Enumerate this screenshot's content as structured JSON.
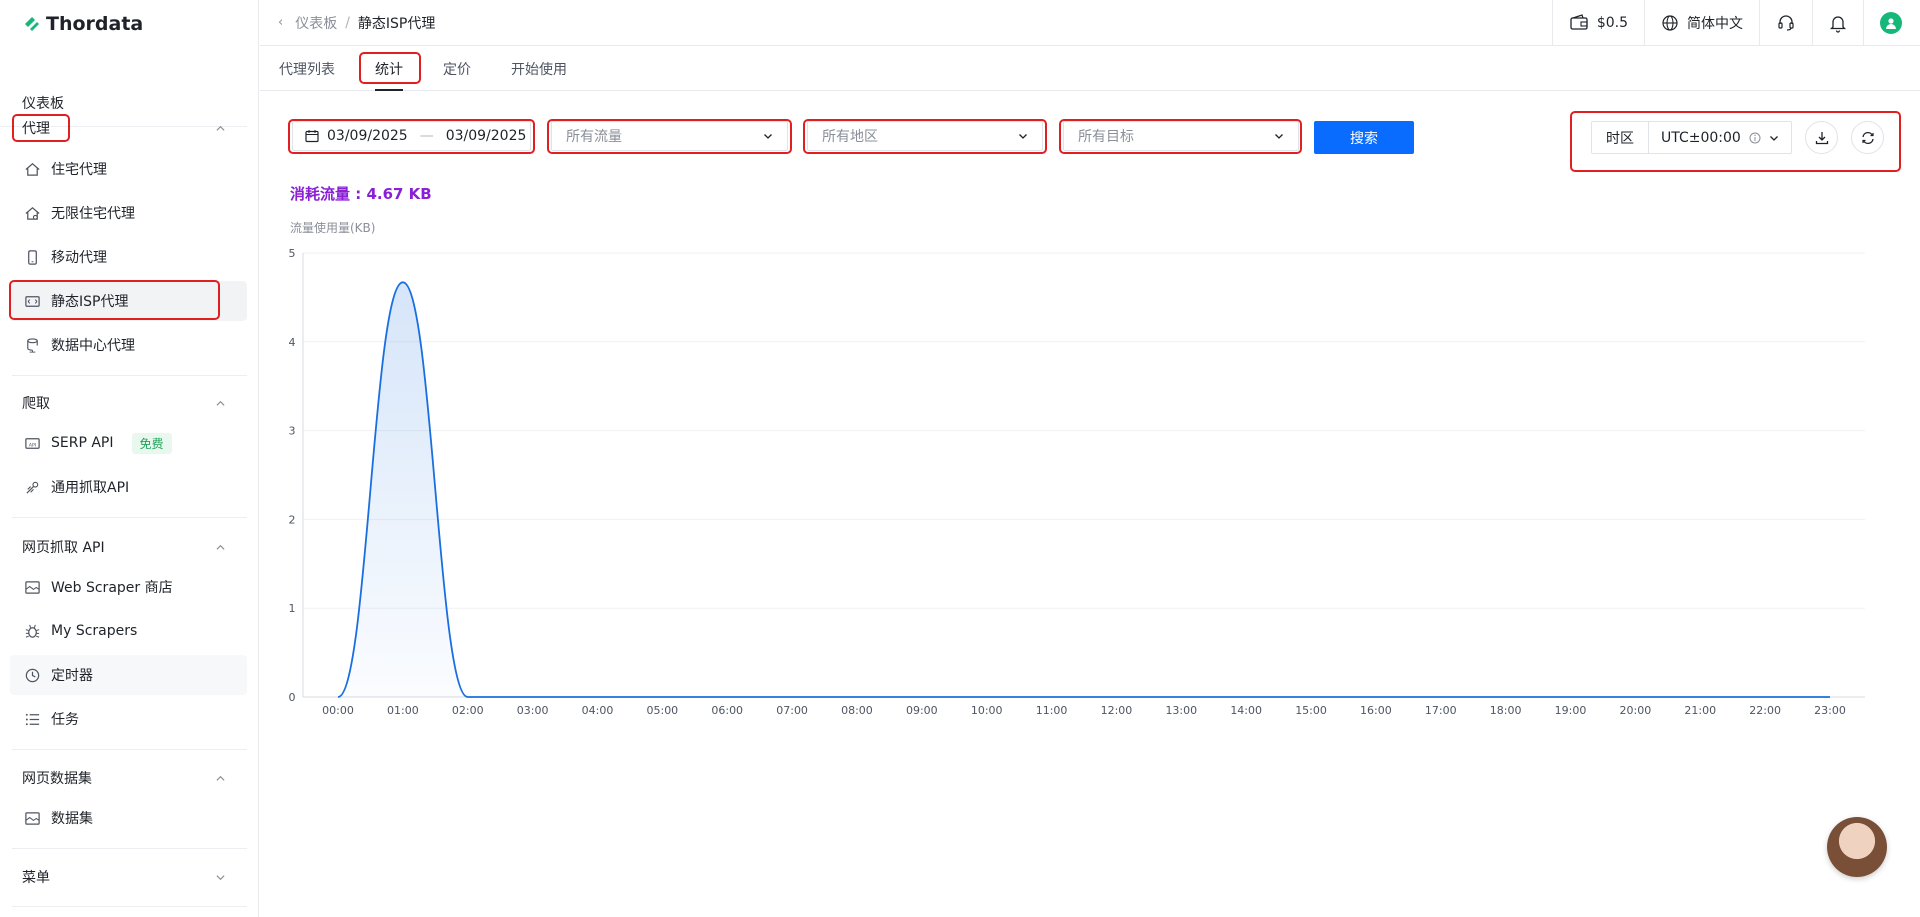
{
  "brand": {
    "name": "Thordata",
    "accent": "#16b87a"
  },
  "sidebar": {
    "dashboard": "仪表板",
    "groups": [
      {
        "title": "代理",
        "items": [
          "住宅代理",
          "无限住宅代理",
          "移动代理",
          "静态ISP代理",
          "数据中心代理"
        ]
      },
      {
        "title": "爬取",
        "items": [
          "SERP API",
          "通用抓取API"
        ],
        "badge": "免费"
      },
      {
        "title": "网页抓取 API",
        "items": [
          "Web Scraper 商店",
          "My Scrapers",
          "定时器",
          "任务"
        ]
      },
      {
        "title": "网页数据集",
        "items": [
          "数据集"
        ]
      },
      {
        "title": "菜单",
        "items": []
      }
    ]
  },
  "breadcrumb": {
    "parent": "仪表板",
    "sep": "/",
    "current": "静态ISP代理"
  },
  "header": {
    "balance": "$0.5",
    "language": "简体中文"
  },
  "tabs": [
    "代理列表",
    "统计",
    "定价",
    "开始使用"
  ],
  "filters": {
    "date_start": "03/09/2025",
    "date_sep": "—",
    "date_end": "03/09/2025",
    "traffic_placeholder": "所有流量",
    "region_placeholder": "所有地区",
    "target_placeholder": "所有目标",
    "search_label": "搜索",
    "timezone_label": "时区",
    "timezone_value": "UTC±00:00"
  },
  "usage": {
    "total_label": "消耗流量 : 4.67 KB",
    "y_axis_label": "流量使用量(KB)"
  },
  "chart_data": {
    "type": "area",
    "title": "",
    "xlabel": "",
    "ylabel": "流量使用量(KB)",
    "ylim": [
      0,
      5
    ],
    "yticks": [
      0,
      1,
      2,
      3,
      4,
      5
    ],
    "x": [
      "00:00",
      "01:00",
      "02:00",
      "03:00",
      "04:00",
      "05:00",
      "06:00",
      "07:00",
      "08:00",
      "09:00",
      "10:00",
      "11:00",
      "12:00",
      "13:00",
      "14:00",
      "15:00",
      "16:00",
      "17:00",
      "18:00",
      "19:00",
      "20:00",
      "21:00",
      "22:00",
      "23:00"
    ],
    "series": [
      {
        "values": [
          0,
          4.67,
          0,
          0,
          0,
          0,
          0,
          0,
          0,
          0,
          0,
          0,
          0,
          0,
          0,
          0,
          0,
          0,
          0,
          0,
          0,
          0,
          0,
          0
        ]
      }
    ],
    "line_color": "#1a6fe0",
    "grid": true,
    "legend": "none"
  }
}
